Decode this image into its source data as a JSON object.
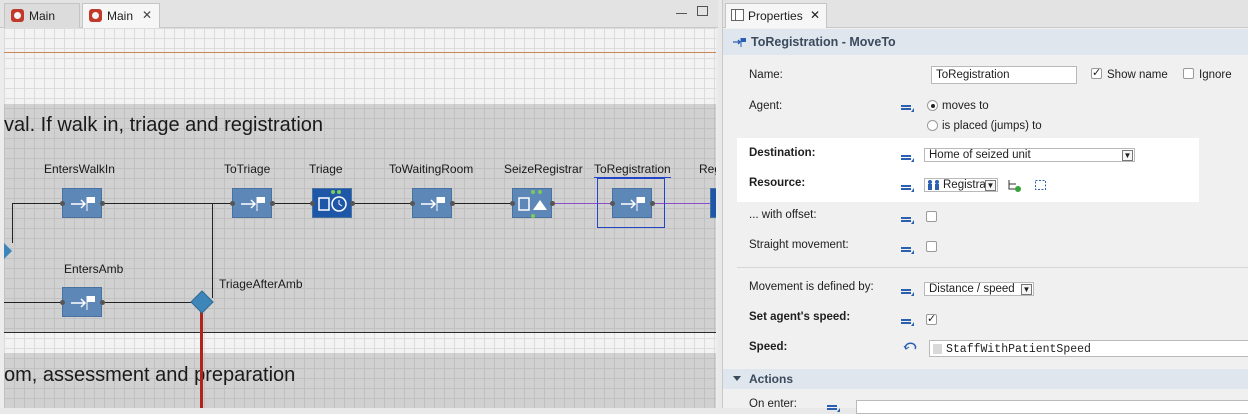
{
  "editor": {
    "tabs": [
      {
        "label": "Main",
        "closable": false
      },
      {
        "label": "Main",
        "closable": true
      }
    ],
    "section_texts": [
      "val. If walk in, triage and registration",
      "om, assessment and preparation"
    ],
    "blocks": {
      "enters_walk_in": "EntersWalkIn",
      "to_triage": "ToTriage",
      "triage": "Triage",
      "to_waiting_room": "ToWaitingRoom",
      "seize_registrar": "SeizeRegistrar",
      "to_registration": "ToRegistration",
      "cut_label": "Reg",
      "enters_amb": "EntersAmb",
      "triage_after_amb": "TriageAfterAmb"
    }
  },
  "properties": {
    "tab_label": "Properties",
    "title": "ToRegistration - MoveTo",
    "name": {
      "label": "Name:",
      "value": "ToRegistration",
      "show_name": "Show name",
      "show_name_checked": true,
      "ignore": "Ignore",
      "ignore_checked": false
    },
    "agent": {
      "label": "Agent:",
      "options": [
        "moves to",
        "is placed (jumps) to"
      ],
      "selected": "moves to"
    },
    "destination": {
      "label": "Destination:",
      "value": "Home of seized unit"
    },
    "resource": {
      "label": "Resource:",
      "value": "Registra"
    },
    "with_offset": {
      "label": "... with offset:",
      "checked": false
    },
    "straight_movement": {
      "label": "Straight movement:",
      "checked": false
    },
    "movement_defined_by": {
      "label": "Movement is defined by:",
      "value": "Distance / speed"
    },
    "set_speed": {
      "label": "Set agent's speed:",
      "checked": true
    },
    "speed": {
      "label": "Speed:",
      "value": "StaffWithPatientSpeed"
    },
    "actions": {
      "label": "Actions",
      "on_enter": "On enter:"
    }
  },
  "colors": {
    "block": "#5c87b7",
    "block_dark": "#1f57a8",
    "selection": "#2444c7",
    "highlight_row": "#ffffff"
  }
}
